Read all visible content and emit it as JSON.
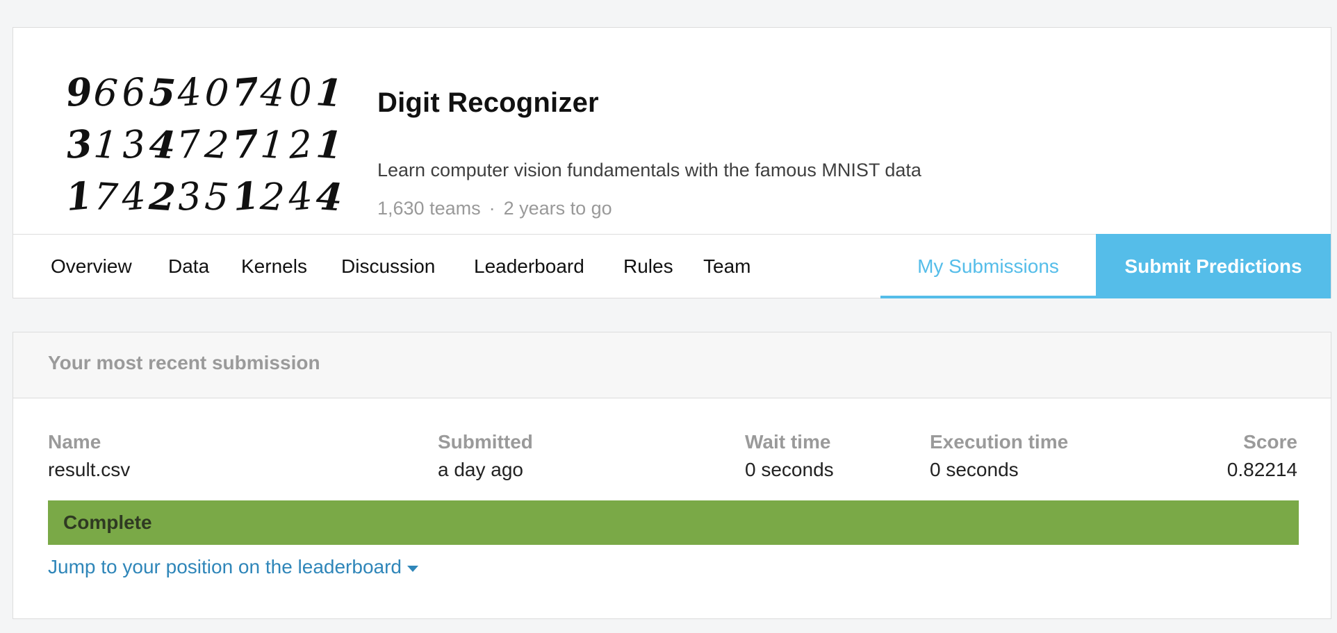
{
  "competition": {
    "title": "Digit Recognizer",
    "description": "Learn computer vision fundamentals with the famous MNIST data",
    "teams": "1,630 teams",
    "separator": "·",
    "deadline": "2 years to go",
    "thumbnail_digits": [
      "9665407401",
      "3134727121",
      "1742351244"
    ]
  },
  "tabs": {
    "items": [
      "Overview",
      "Data",
      "Kernels",
      "Discussion",
      "Leaderboard",
      "Rules",
      "Team"
    ],
    "my_submissions": "My Submissions",
    "submit_predictions": "Submit Predictions",
    "accent_color": "#55bde9"
  },
  "submission": {
    "section_title": "Your most recent submission",
    "columns": {
      "name_label": "Name",
      "name_value": "result.csv",
      "submitted_label": "Submitted",
      "submitted_value": "a day ago",
      "wait_label": "Wait time",
      "wait_value": "0 seconds",
      "exec_label": "Execution time",
      "exec_value": "0 seconds",
      "score_label": "Score",
      "score_value": "0.82214"
    },
    "status": "Complete",
    "status_color": "#7aa947",
    "jump_link": "Jump to your position on the leaderboard"
  }
}
